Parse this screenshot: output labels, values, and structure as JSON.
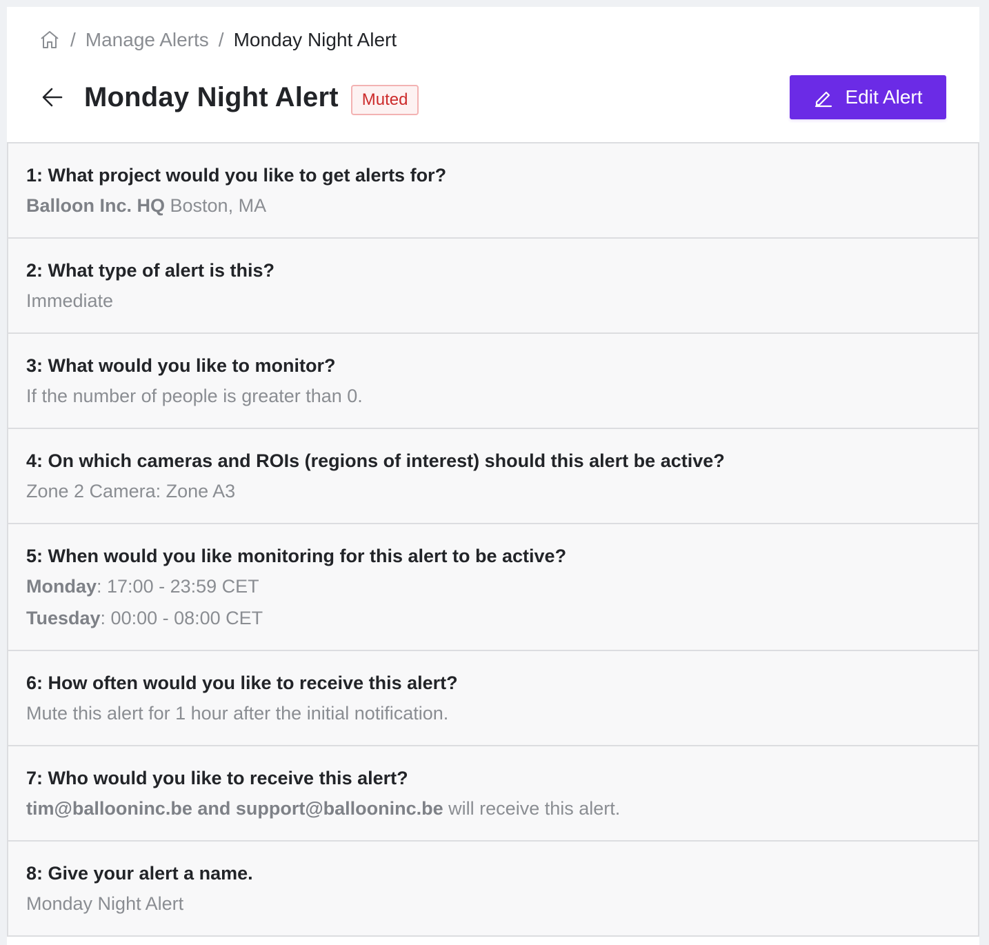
{
  "breadcrumb": {
    "home_icon": "home-icon",
    "separator": "/",
    "manage_alerts": "Manage Alerts",
    "current": "Monday Night Alert"
  },
  "header": {
    "back_icon": "arrow-left-icon",
    "title": "Monday Night Alert",
    "status": "Muted",
    "edit_button_label": "Edit Alert",
    "edit_icon": "pencil-icon",
    "colors": {
      "accent": "#6b2be6",
      "muted_text": "#cc2b2b",
      "muted_bg": "#fdf2f2",
      "muted_border": "#f3b2b2"
    }
  },
  "questions": [
    {
      "title": "1: What project would you like to get alerts for?",
      "answer_bold": "Balloon Inc. HQ",
      "answer_rest": " Boston, MA"
    },
    {
      "title": "2: What type of alert is this?",
      "answer": "Immediate"
    },
    {
      "title": "3: What would you like to monitor?",
      "answer": "If the number of people is greater than 0."
    },
    {
      "title": "4: On which cameras and ROIs (regions of interest) should this alert be active?",
      "answer": "Zone 2 Camera: Zone A3"
    },
    {
      "title": "5: When would you like monitoring for this alert to be active?",
      "schedule": [
        {
          "day": "Monday",
          "time": ": 17:00 - 23:59 CET"
        },
        {
          "day": "Tuesday",
          "time": ": 00:00 - 08:00 CET"
        }
      ]
    },
    {
      "title": "6: How often would you like to receive this alert?",
      "answer": "Mute this alert for 1 hour after the initial notification."
    },
    {
      "title": "7: Who would you like to receive this alert?",
      "answer_bold": "tim@ballooninc.be and support@ballooninc.be",
      "answer_rest": " will receive this alert."
    },
    {
      "title": "8: Give your alert a name.",
      "answer": "Monday Night Alert"
    }
  ]
}
